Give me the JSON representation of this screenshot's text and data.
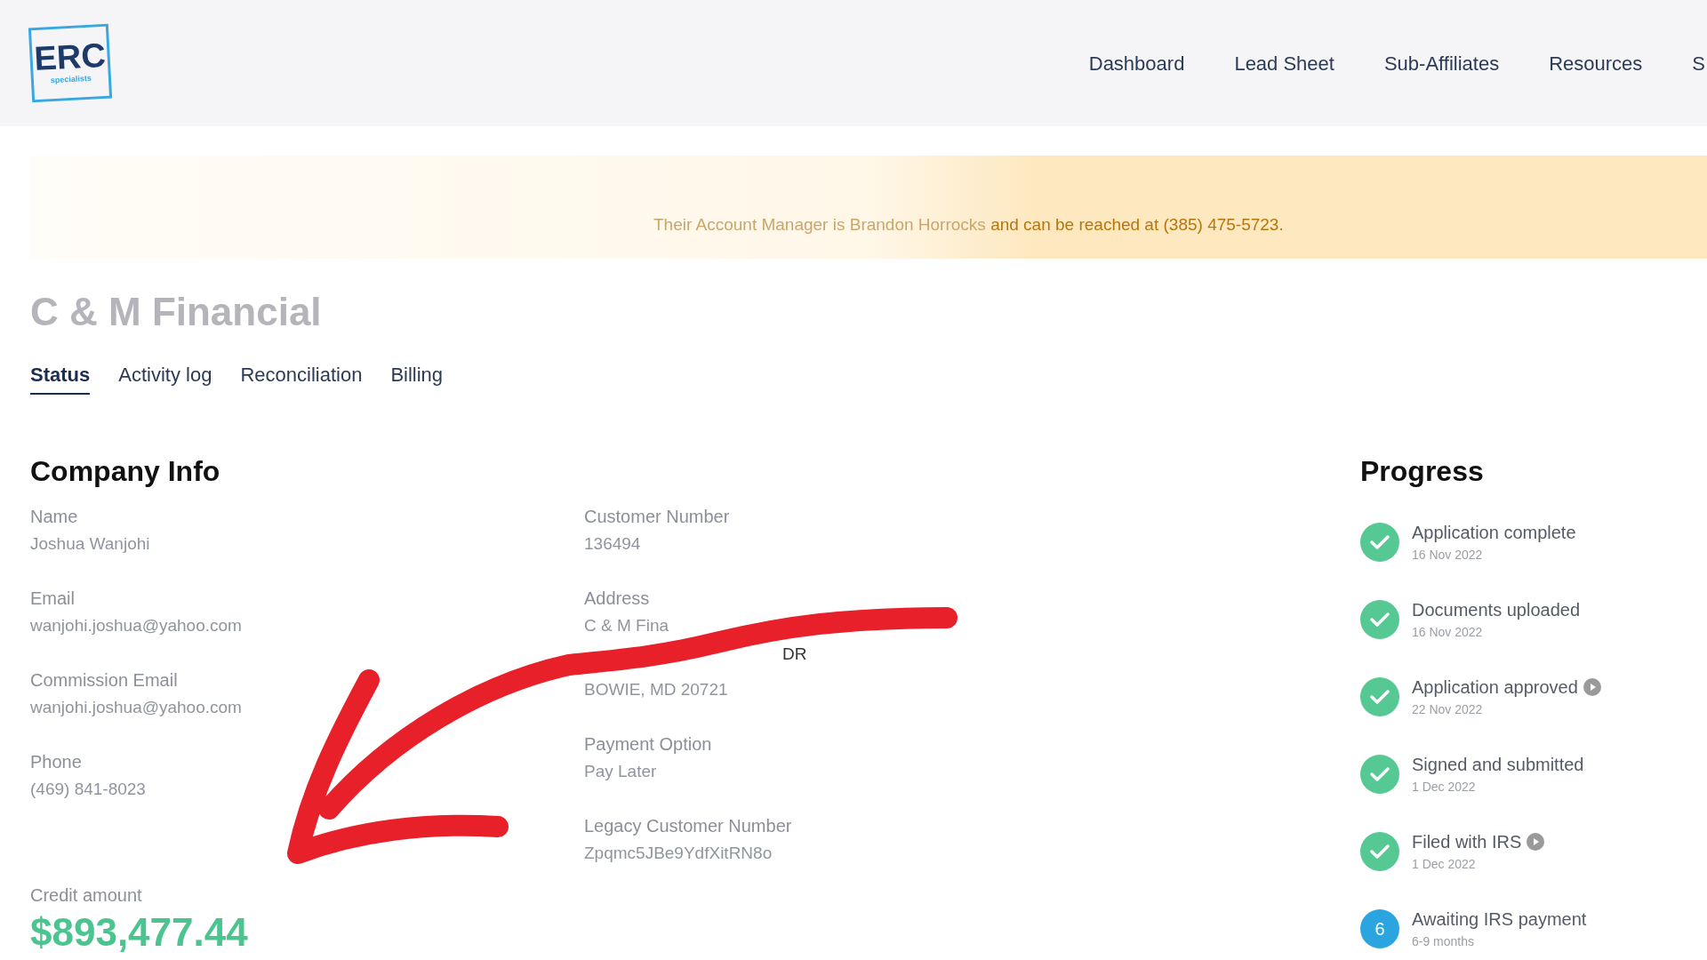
{
  "header": {
    "logo": {
      "text": "ERC",
      "subtext": "specialists"
    },
    "nav": [
      {
        "label": "Dashboard"
      },
      {
        "label": "Lead Sheet"
      },
      {
        "label": "Sub-Affiliates"
      },
      {
        "label": "Resources"
      },
      {
        "label": "S"
      }
    ]
  },
  "banner": {
    "faded_text": "Their Account Manager is Brandon Horrocks",
    "text": "and can be reached at (385) 475-5723."
  },
  "company_title": "C & M Financial",
  "tabs": [
    {
      "label": "Status",
      "selected": true
    },
    {
      "label": "Activity log",
      "selected": false
    },
    {
      "label": "Reconciliation",
      "selected": false
    },
    {
      "label": "Billing",
      "selected": false
    }
  ],
  "company_info": {
    "title": "Company Info",
    "left_fields": [
      {
        "label": "Name",
        "values": [
          "Joshua Wanjohi"
        ]
      },
      {
        "label": "Email",
        "values": [
          "wanjohi.joshua@yahoo.com"
        ]
      },
      {
        "label": "Commission Email",
        "values": [
          "wanjohi.joshua@yahoo.com"
        ]
      },
      {
        "label": "Phone",
        "values": [
          "(469) 841-8023"
        ]
      }
    ],
    "right_fields": [
      {
        "label": "Customer Number",
        "values": [
          "136494"
        ]
      },
      {
        "label": "Address",
        "values": [
          "C & M Fina",
          "DR",
          "BOWIE, MD 20721"
        ]
      },
      {
        "label": "Payment Option",
        "values": [
          "Pay Later"
        ]
      },
      {
        "label": "Legacy Customer Number",
        "values": [
          "Zpqmc5JBe9YdfXitRN8o"
        ]
      }
    ],
    "credit": {
      "label": "Credit amount",
      "value": "$893,477.44"
    }
  },
  "progress": {
    "title": "Progress",
    "steps": [
      {
        "title": "Application complete",
        "date": "16 Nov 2022",
        "kind": "done",
        "play": false
      },
      {
        "title": "Documents uploaded",
        "date": "16 Nov 2022",
        "kind": "done",
        "play": false
      },
      {
        "title": "Application approved",
        "date": "22 Nov 2022",
        "kind": "done",
        "play": true
      },
      {
        "title": "Signed and submitted",
        "date": "1 Dec 2022",
        "kind": "done",
        "play": false
      },
      {
        "title": "Filed with IRS",
        "date": "1 Dec 2022",
        "kind": "done",
        "play": true
      },
      {
        "title": "Awaiting IRS payment",
        "date": "6-9 months",
        "kind": "pending",
        "number": "6",
        "play": false
      }
    ]
  }
}
